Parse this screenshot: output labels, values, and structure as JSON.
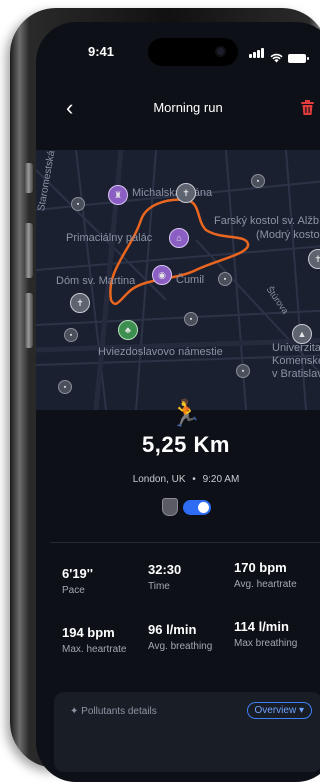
{
  "status_bar": {
    "time": "9:41"
  },
  "header": {
    "title": "Morning run",
    "back_icon": "chevron-left-icon",
    "delete_icon": "trash-icon",
    "delete_color": "#e23b3b"
  },
  "map": {
    "labels": [
      "Michalská brána",
      "Primaciálny palác",
      "Farský kostol sv. Alžb",
      "(Modrý kostol",
      "Dóm sv. Martina",
      "Čumil",
      "Hviezdoslavovo námestie",
      "Univerzita",
      "Komenského",
      "v Bratislave",
      "Staromestská",
      "Štúrova"
    ],
    "route_color": "#e8661f"
  },
  "activity": {
    "icon": "runner-icon",
    "distance": "5,25 Km",
    "location": "London, UK",
    "separator": "•",
    "time": "9:20 AM",
    "toggle_on": true,
    "accent": "#2e6df3"
  },
  "stats": [
    {
      "value": "6'19''",
      "label": "Pace"
    },
    {
      "value": "32:30",
      "label": "Time"
    },
    {
      "value": "170 bpm",
      "label": "Avg. heartrate"
    },
    {
      "value": "194 bpm",
      "label": "Max. heartrate"
    },
    {
      "value": "96 l/min",
      "label": "Avg. breathing"
    },
    {
      "value": "114 l/min",
      "label": "Max breathing"
    }
  ],
  "pollutants": {
    "label": "Pollutants details",
    "dropdown": "Overview"
  }
}
